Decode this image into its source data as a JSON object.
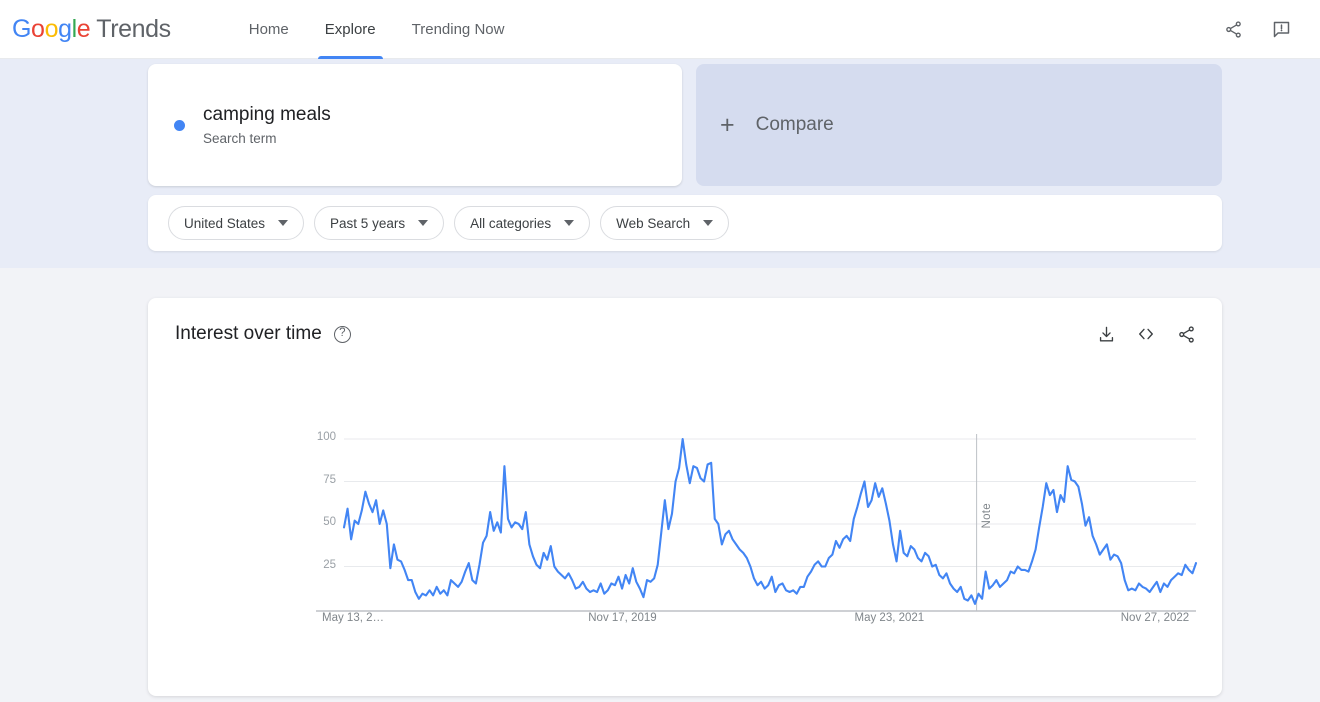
{
  "header": {
    "logo": {
      "google": "Google",
      "product": "Trends",
      "letters": [
        {
          "ch": "G",
          "color": "#4285F4"
        },
        {
          "ch": "o",
          "color": "#EA4335"
        },
        {
          "ch": "o",
          "color": "#FBBC05"
        },
        {
          "ch": "g",
          "color": "#4285F4"
        },
        {
          "ch": "l",
          "color": "#34A853"
        },
        {
          "ch": "e",
          "color": "#EA4335"
        }
      ]
    },
    "nav": [
      {
        "label": "Home",
        "active": false
      },
      {
        "label": "Explore",
        "active": true
      },
      {
        "label": "Trending Now",
        "active": false
      }
    ],
    "actions": [
      {
        "name": "share-icon",
        "label": "Share"
      },
      {
        "name": "feedback-icon",
        "label": "Send feedback"
      }
    ]
  },
  "query": {
    "term": {
      "title": "camping meals",
      "subtitle": "Search term",
      "dot_color": "#4285F4"
    },
    "compare": {
      "plus": "+",
      "label": "Compare"
    }
  },
  "filters": [
    {
      "name": "location-filter",
      "label": "United States"
    },
    {
      "name": "time-range-filter",
      "label": "Past 5 years"
    },
    {
      "name": "category-filter",
      "label": "All categories"
    },
    {
      "name": "search-type-filter",
      "label": "Web Search"
    }
  ],
  "chart_card": {
    "title": "Interest over time",
    "help": "?",
    "tools": [
      {
        "name": "download-icon",
        "label": "Download CSV"
      },
      {
        "name": "embed-code-icon",
        "label": "Embed"
      },
      {
        "name": "share-icon",
        "label": "Share"
      }
    ]
  },
  "chart_data": {
    "type": "line",
    "title": "Interest over time",
    "subtitle": "camping meals — United States, Past 5 years, All categories, Web Search",
    "xlabel": "",
    "ylabel": "",
    "ylim": [
      0,
      100
    ],
    "yticks": [
      25,
      50,
      75,
      100
    ],
    "ytick_labels": [
      "25",
      "50",
      "75",
      "100"
    ],
    "grid": true,
    "legend": false,
    "line_color": "#4285F4",
    "x_tick_labels": [
      "May 13, 2…",
      "Nov 17, 2019",
      "May 23, 2021",
      "Nov 27, 2022"
    ],
    "x_tick_positions": [
      0,
      0.3125,
      0.625,
      0.9375
    ],
    "x_start": "May 13, 2018",
    "x_end": "May 2023",
    "annotations": [
      {
        "label": "Note",
        "x_fraction": 0.7425,
        "type": "vertical-line"
      }
    ],
    "series": [
      {
        "name": "camping meals",
        "color": "#4285F4",
        "values": [
          48,
          59,
          41,
          52,
          50,
          58,
          69,
          62,
          57,
          64,
          50,
          58,
          50,
          24,
          38,
          29,
          28,
          23,
          17,
          17,
          10,
          6,
          9,
          8,
          11,
          8,
          13,
          9,
          11,
          8,
          17,
          15,
          13,
          16,
          22,
          27,
          17,
          15,
          26,
          39,
          43,
          57,
          46,
          51,
          45,
          84,
          53,
          48,
          51,
          50,
          47,
          57,
          38,
          31,
          26,
          24,
          33,
          29,
          37,
          25,
          22,
          20,
          18,
          21,
          17,
          12,
          13,
          16,
          12,
          10,
          11,
          10,
          15,
          9,
          11,
          15,
          14,
          19,
          12,
          20,
          15,
          24,
          16,
          12,
          7,
          17,
          16,
          18,
          26,
          45,
          64,
          47,
          56,
          75,
          83,
          100,
          85,
          74,
          84,
          83,
          77,
          75,
          85,
          86,
          53,
          50,
          38,
          44,
          46,
          41,
          38,
          35,
          33,
          30,
          25,
          18,
          14,
          16,
          12,
          14,
          19,
          10,
          14,
          15,
          11,
          10,
          11,
          9,
          13,
          13,
          19,
          22,
          26,
          28,
          25,
          25,
          30,
          32,
          40,
          36,
          41,
          43,
          40,
          53,
          60,
          68,
          75,
          60,
          64,
          74,
          66,
          71,
          62,
          52,
          38,
          28,
          46,
          33,
          31,
          37,
          35,
          30,
          28,
          33,
          31,
          25,
          26,
          20,
          18,
          21,
          15,
          12,
          10,
          13,
          6,
          5,
          8,
          3,
          9,
          6,
          22,
          12,
          14,
          17,
          13,
          15,
          17,
          22,
          21,
          25,
          23,
          23,
          22,
          28,
          35,
          48,
          60,
          74,
          67,
          70,
          57,
          67,
          63,
          84,
          76,
          75,
          72,
          62,
          49,
          54,
          43,
          38,
          32,
          35,
          38,
          29,
          32,
          31,
          27,
          17,
          11,
          12,
          11,
          15,
          13,
          12,
          10,
          13,
          16,
          10,
          15,
          13,
          17,
          19,
          21,
          20,
          26,
          23,
          21,
          27
        ]
      }
    ]
  }
}
